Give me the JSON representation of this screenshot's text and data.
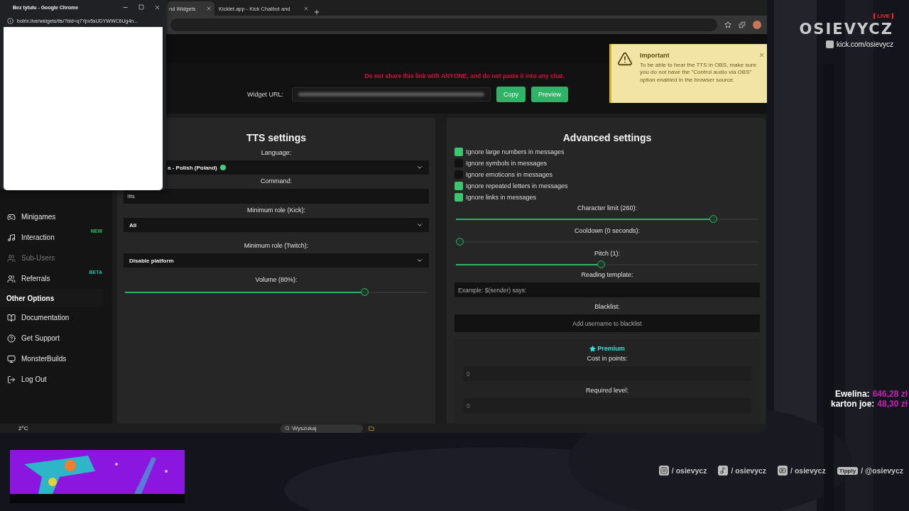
{
  "popup": {
    "title": "Bez tytułu - Google Chrome",
    "url": "botrix.live/widgets/tts/?bid=q7Ypv5sUDYWWC6Ug4n..."
  },
  "tabs": [
    {
      "label": "nd Widgets",
      "selected": true
    },
    {
      "label": "Kicklet.app - Kick Chatbot and",
      "selected": false
    }
  ],
  "warning": "Do not share this link with ANYONE, and do not paste it into any chat.",
  "widget_url": {
    "label": "Widget URL:",
    "buttons": [
      "Copy",
      "Preview"
    ]
  },
  "toast": {
    "title": "Important",
    "text": "To be able to hear the TTS in OBS, make sure you do not have the \"Control audio via OBS\" option enabled in the browser source."
  },
  "sidebar": {
    "items": [
      {
        "label": "Minigames",
        "disabled": false
      },
      {
        "label": "Interaction",
        "disabled": false,
        "badge": "NEW",
        "color": "#22c55e"
      },
      {
        "label": "Sub-Users",
        "disabled": true
      },
      {
        "label": "Referrals",
        "disabled": false,
        "badge": "BETA",
        "color": "#14b8a6"
      }
    ],
    "section_title": "Other Options",
    "other_items": [
      {
        "label": "Documentation"
      },
      {
        "label": "Get Support"
      },
      {
        "label": "MonsterBuilds"
      },
      {
        "label": "Log Out"
      }
    ]
  },
  "tts_settings": {
    "title": "TTS settings",
    "fields": [
      {
        "kind": "select",
        "label": "Language:",
        "value": "a - Polish (Poland)",
        "dot": true
      },
      {
        "kind": "input",
        "label": "Command:",
        "value": "!tts"
      },
      {
        "kind": "select",
        "label": "Minimum role (Kick):",
        "value": "All"
      },
      {
        "kind": "select",
        "label": "Minimum role (Twitch):",
        "value": "Disable platform"
      },
      {
        "kind": "slider",
        "label": "Volume (80%):",
        "level": 0.8
      }
    ]
  },
  "advanced_settings": {
    "title": "Advanced settings",
    "checkboxes": [
      {
        "label": "Ignore large numbers in messages",
        "checked": true
      },
      {
        "label": "Ignore symbols in messages",
        "checked": false
      },
      {
        "label": "Ignore emoticons in messages",
        "checked": false
      },
      {
        "label": "Ignore repeated letters in messages",
        "checked": true
      },
      {
        "label": "Ignore links in messages",
        "checked": true
      }
    ],
    "sliders": [
      {
        "label": "Character limit (260):",
        "level": 0.86
      },
      {
        "label": "Cooldown (0 seconds):",
        "level": 0
      },
      {
        "label": "Pitch (1):",
        "level": 0.48
      }
    ],
    "template": {
      "label": "Reading template:",
      "placeholder": "Example: $(sender) says:"
    },
    "blacklist": {
      "label": "Blacklist:",
      "placeholder": "Add username to blacklist"
    },
    "premium": {
      "title": "Premium",
      "fields": [
        {
          "label": "Cost in points:",
          "placeholder": "0"
        },
        {
          "label": "Required level:",
          "placeholder": "0"
        }
      ]
    }
  },
  "taskbar": {
    "weather": "2°C",
    "search_placeholder": "Wyszukaj"
  },
  "overlay": {
    "live": "LIVE",
    "logo": "OSIEVYCZ",
    "kick": "kick.com/osievycz",
    "donations": [
      {
        "name": "Ewelina:",
        "amount": "646,28 zł"
      },
      {
        "name": "karton joe:",
        "amount": "48,30 zł"
      }
    ],
    "socials": [
      {
        "kind": "instagram",
        "handle": "/ osievycz"
      },
      {
        "kind": "tiktok",
        "handle": "/ osievycz"
      },
      {
        "kind": "youtube",
        "handle": "/ osievycz"
      },
      {
        "kind": "tipply",
        "badge": "Tipply",
        "handle": "/ @osievycz"
      }
    ]
  }
}
